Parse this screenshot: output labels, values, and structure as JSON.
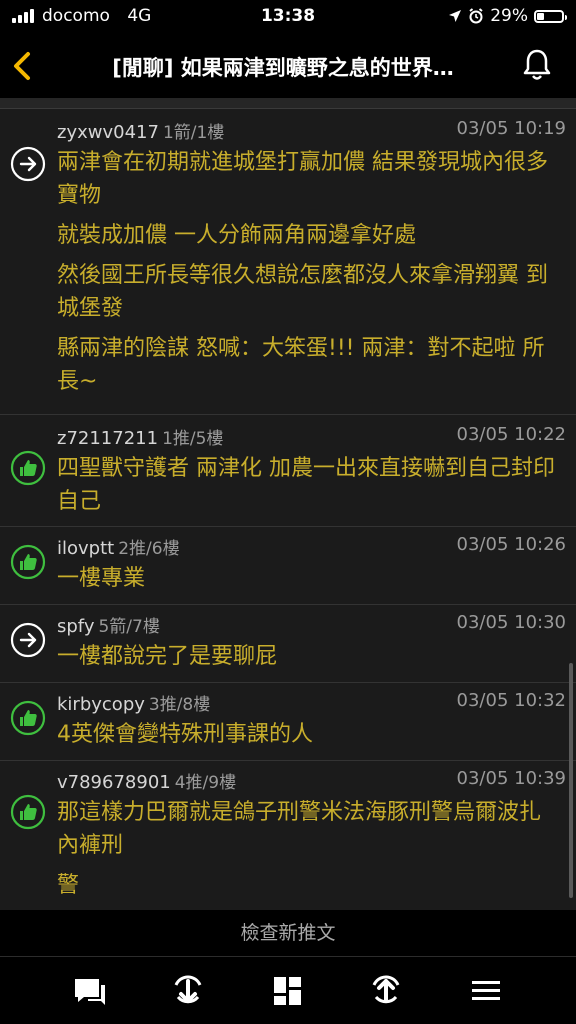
{
  "status_bar": {
    "carrier": "docomo",
    "network": "4G",
    "time": "13:38",
    "battery_text": "29%",
    "battery_level": 0.29
  },
  "nav": {
    "title": "[閒聊] 如果兩津到曠野之息的世界…"
  },
  "comments": [
    {
      "user": "zyxwv0417",
      "score": "1箭/1樓",
      "time": "03/05 10:19",
      "icon": "arrow-right-icon",
      "lines": [
        "兩津會在初期就進城堡打贏加儂 結果發現城內很多寶物",
        "就裝成加儂 一人分飾兩角兩邊拿好處",
        "然後國王所長等很久想說怎麼都沒人來拿滑翔翼 到城堡發",
        "縣兩津的陰謀 怒喊：大笨蛋!!! 兩津：對不起啦 所長~"
      ]
    },
    {
      "user": "z72117211",
      "score": "1推/5樓",
      "time": "03/05 10:22",
      "icon": "thumbs-up-icon",
      "lines": [
        "四聖獸守護者 兩津化 加農一出來直接嚇到自己封印自己"
      ]
    },
    {
      "user": "ilovptt",
      "score": "2推/6樓",
      "time": "03/05 10:26",
      "icon": "thumbs-up-icon",
      "lines": [
        "一樓專業"
      ]
    },
    {
      "user": "spfy",
      "score": "5箭/7樓",
      "time": "03/05 10:30",
      "icon": "arrow-right-icon",
      "lines": [
        "一樓都說完了是要聊屁"
      ]
    },
    {
      "user": "kirbycopy",
      "score": "3推/8樓",
      "time": "03/05 10:32",
      "icon": "thumbs-up-icon",
      "lines": [
        "4英傑會變特殊刑事課的人"
      ]
    },
    {
      "user": "v789678901",
      "score": "4推/9樓",
      "time": "03/05 10:39",
      "icon": "thumbs-up-icon",
      "lines": [
        "那這樣力巴爾就是鴿子刑警米法海豚刑警烏爾波扎內褲刑",
        "警"
      ]
    }
  ],
  "check_new_label": "檢查新推文",
  "bottom_tabs": [
    {
      "name": "comment-icon"
    },
    {
      "name": "scroll-down-icon"
    },
    {
      "name": "grid-icon"
    },
    {
      "name": "refresh-up-icon"
    },
    {
      "name": "menu-icon"
    }
  ],
  "colors": {
    "accent": "#f5b800",
    "comment_text": "#c8ae2c",
    "push_green": "#3fbf3f",
    "background": "#1b1b1b"
  }
}
